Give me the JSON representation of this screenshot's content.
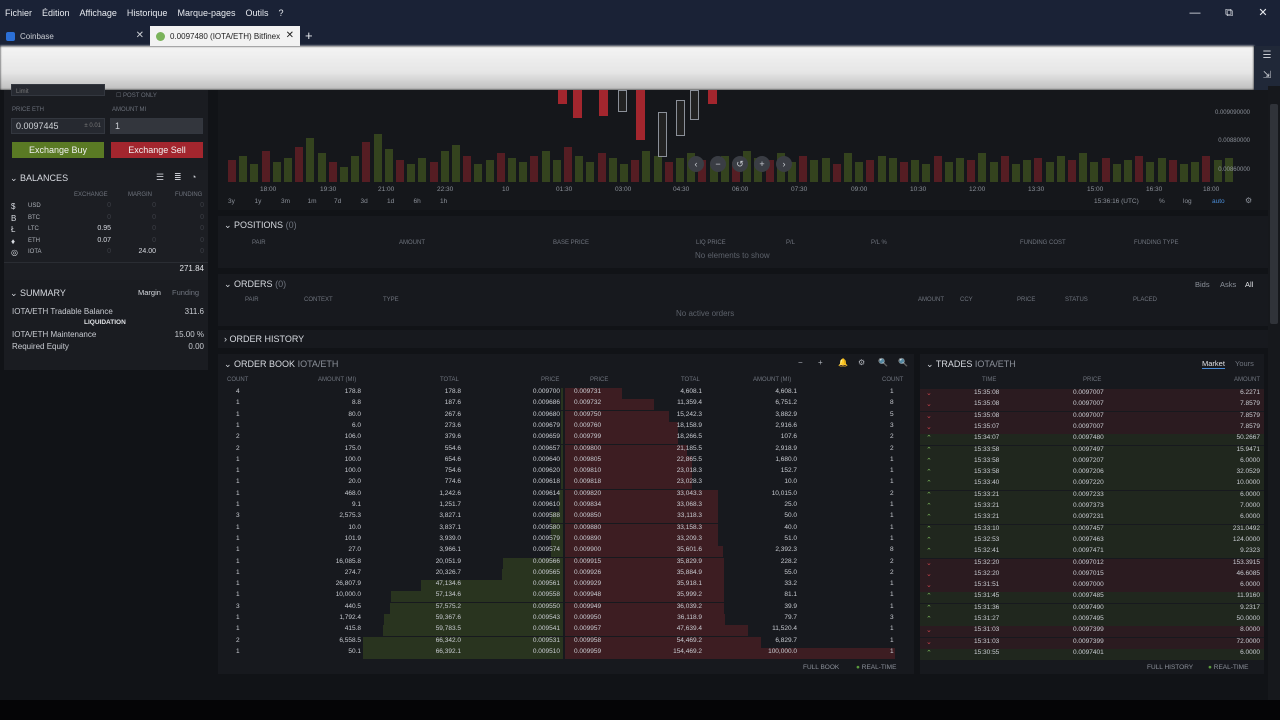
{
  "menu": {
    "items": [
      "Fichier",
      "Édition",
      "Affichage",
      "Historique",
      "Marque-pages",
      "Outils",
      "?"
    ]
  },
  "window_controls": {
    "minimize": "—",
    "maximize": "⧉",
    "close": "✕"
  },
  "tabs": [
    {
      "label": "Coinbase",
      "close": "✕"
    },
    {
      "label": "0.0097480 (IOTA/ETH) Bitfinex",
      "close": "✕"
    }
  ],
  "new_tab": "+",
  "order_form": {
    "type_value": "Limit",
    "post_only": "POST ONLY",
    "price_label": "PRICE ETH",
    "amount_label": "AMOUNT MI",
    "price_value": "0.0097445",
    "price_hint": "± 0.01",
    "amount_value": "1",
    "buy_label": "Exchange Buy",
    "sell_label": "Exchange Sell"
  },
  "balances": {
    "title": "BALANCES",
    "headers": [
      "EXCHANGE",
      "MARGIN",
      "FUNDING"
    ],
    "rows": [
      {
        "sym": "$",
        "cur": "USD",
        "ex": "0",
        "mar": "0",
        "fun": "0"
      },
      {
        "sym": "B",
        "cur": "BTC",
        "ex": "0",
        "mar": "0",
        "fun": "0"
      },
      {
        "sym": "Ł",
        "cur": "LTC",
        "ex": "0.95",
        "mar": "0",
        "fun": "0"
      },
      {
        "sym": "♦",
        "cur": "ETH",
        "ex": "0.07",
        "mar": "0",
        "fun": "0"
      },
      {
        "sym": "◎",
        "cur": "IOTA",
        "ex": "0",
        "mar": "24.00",
        "fun": "0"
      }
    ],
    "total": "271.84"
  },
  "summary": {
    "title": "SUMMARY",
    "tab_margin": "Margin",
    "tab_funding": "Funding",
    "tradable_label": "IOTA/ETH Tradable Balance",
    "tradable_value": "311.6",
    "liquidation": "LIQUIDATION",
    "maintenance_label": "IOTA/ETH Maintenance",
    "maintenance_value": "15.00 %",
    "required_label": "Required Equity",
    "required_value": "0.00"
  },
  "chart": {
    "x_ticks": [
      "18:00",
      "19:30",
      "21:00",
      "22:30",
      "10",
      "01:30",
      "03:00",
      "04:30",
      "06:00",
      "07:30",
      "09:00",
      "10:30",
      "12:00",
      "13:30",
      "15:00",
      "16:30",
      "18:00"
    ],
    "y_ticks": [
      "0.009090000",
      "0.00880000",
      "0.00860000"
    ],
    "timeframes": [
      "3y",
      "1y",
      "3m",
      "1m",
      "7d",
      "3d",
      "1d",
      "6h",
      "1h"
    ],
    "time_label": "15:36:16 (UTC)",
    "pct": "%",
    "log": "log",
    "auto": "auto",
    "gear": "⚙"
  },
  "positions": {
    "title": "POSITIONS",
    "count": "(0)",
    "headers": [
      "PAIR",
      "AMOUNT",
      "BASE PRICE",
      "LIQ PRICE",
      "P/L",
      "P/L %",
      "FUNDING COST",
      "FUNDING TYPE"
    ],
    "empty": "No elements to show"
  },
  "orders": {
    "title": "ORDERS",
    "count": "(0)",
    "headers": [
      "PAIR",
      "CONTEXT",
      "TYPE",
      "AMOUNT",
      "CCY",
      "PRICE",
      "STATUS",
      "PLACED"
    ],
    "empty": "No active orders",
    "filters": [
      "Bids",
      "Asks",
      "All"
    ]
  },
  "order_history": {
    "title": "ORDER HISTORY"
  },
  "order_book": {
    "title": "ORDER BOOK",
    "pair": "IOTA/ETH",
    "icons": [
      "−",
      "+",
      "🔔",
      "⚙",
      "🔍",
      "🔍"
    ],
    "headers_bid": [
      "COUNT",
      "AMOUNT (MI)",
      "TOTAL",
      "PRICE"
    ],
    "headers_ask": [
      "PRICE",
      "TOTAL",
      "AMOUNT (MI)",
      "COUNT"
    ],
    "bids": [
      [
        "4",
        "178.8",
        "178.8",
        "0.009700"
      ],
      [
        "1",
        "8.8",
        "187.6",
        "0.009686"
      ],
      [
        "1",
        "80.0",
        "267.6",
        "0.009680"
      ],
      [
        "1",
        "6.0",
        "273.6",
        "0.009679"
      ],
      [
        "2",
        "106.0",
        "379.6",
        "0.009659"
      ],
      [
        "2",
        "175.0",
        "554.6",
        "0.009657"
      ],
      [
        "1",
        "100.0",
        "654.6",
        "0.009640"
      ],
      [
        "1",
        "100.0",
        "754.6",
        "0.009620"
      ],
      [
        "1",
        "20.0",
        "774.6",
        "0.009618"
      ],
      [
        "1",
        "468.0",
        "1,242.6",
        "0.009614"
      ],
      [
        "1",
        "9.1",
        "1,251.7",
        "0.009610"
      ],
      [
        "3",
        "2,575.3",
        "3,827.1",
        "0.009588"
      ],
      [
        "1",
        "10.0",
        "3,837.1",
        "0.009580"
      ],
      [
        "1",
        "101.9",
        "3,939.0",
        "0.009579"
      ],
      [
        "1",
        "27.0",
        "3,966.1",
        "0.009574"
      ],
      [
        "1",
        "16,085.8",
        "20,051.9",
        "0.009566"
      ],
      [
        "1",
        "274.7",
        "20,326.7",
        "0.009565"
      ],
      [
        "1",
        "26,807.9",
        "47,134.6",
        "0.009561"
      ],
      [
        "1",
        "10,000.0",
        "57,134.6",
        "0.009558"
      ],
      [
        "3",
        "440.5",
        "57,575.2",
        "0.009550"
      ],
      [
        "1",
        "1,792.4",
        "59,367.6",
        "0.009543"
      ],
      [
        "1",
        "415.8",
        "59,783.5",
        "0.009541"
      ],
      [
        "2",
        "6,558.5",
        "66,342.0",
        "0.009531"
      ],
      [
        "1",
        "50.1",
        "66,392.1",
        "0.009510"
      ]
    ],
    "asks": [
      [
        "0.009731",
        "4,608.1",
        "4,608.1",
        "1"
      ],
      [
        "0.009732",
        "11,359.4",
        "6,751.2",
        "8"
      ],
      [
        "0.009750",
        "15,242.3",
        "3,882.9",
        "5"
      ],
      [
        "0.009760",
        "18,158.9",
        "2,916.6",
        "3"
      ],
      [
        "0.009799",
        "18,266.5",
        "107.6",
        "2"
      ],
      [
        "0.009800",
        "21,185.5",
        "2,918.9",
        "2"
      ],
      [
        "0.009805",
        "22,865.5",
        "1,680.0",
        "1"
      ],
      [
        "0.009810",
        "23,018.3",
        "152.7",
        "1"
      ],
      [
        "0.009818",
        "23,028.3",
        "10.0",
        "1"
      ],
      [
        "0.009820",
        "33,043.3",
        "10,015.0",
        "2"
      ],
      [
        "0.009834",
        "33,068.3",
        "25.0",
        "1"
      ],
      [
        "0.009850",
        "33,118.3",
        "50.0",
        "1"
      ],
      [
        "0.009880",
        "33,158.3",
        "40.0",
        "1"
      ],
      [
        "0.009890",
        "33,209.3",
        "51.0",
        "1"
      ],
      [
        "0.009900",
        "35,601.6",
        "2,392.3",
        "8"
      ],
      [
        "0.009915",
        "35,829.9",
        "228.2",
        "2"
      ],
      [
        "0.009926",
        "35,884.9",
        "55.0",
        "2"
      ],
      [
        "0.009929",
        "35,918.1",
        "33.2",
        "1"
      ],
      [
        "0.009948",
        "35,999.2",
        "81.1",
        "1"
      ],
      [
        "0.009949",
        "36,039.2",
        "39.9",
        "1"
      ],
      [
        "0.009950",
        "36,118.9",
        "79.7",
        "3"
      ],
      [
        "0.009957",
        "47,639.4",
        "11,520.4",
        "1"
      ],
      [
        "0.009958",
        "54,469.2",
        "6,829.7",
        "1"
      ],
      [
        "0.009959",
        "154,469.2",
        "100,000.0",
        "1"
      ]
    ],
    "full_book": "FULL BOOK",
    "realtime": "REAL-TIME"
  },
  "trades": {
    "title": "TRADES",
    "pair": "IOTA/ETH",
    "tab_market": "Market",
    "tab_yours": "Yours",
    "headers": [
      "TIME",
      "PRICE",
      "AMOUNT"
    ],
    "rows": [
      [
        "dn",
        "15:35:08",
        "0.0097007",
        "6.2271"
      ],
      [
        "dn",
        "15:35:08",
        "0.0097007",
        "7.8579"
      ],
      [
        "dn",
        "15:35:08",
        "0.0097007",
        "7.8579"
      ],
      [
        "dn",
        "15:35:07",
        "0.0097007",
        "7.8579"
      ],
      [
        "up",
        "15:34:07",
        "0.0097480",
        "50.2667"
      ],
      [
        "up",
        "15:33:58",
        "0.0097497",
        "15.9471"
      ],
      [
        "up",
        "15:33:58",
        "0.0097207",
        "6.0000"
      ],
      [
        "up",
        "15:33:58",
        "0.0097206",
        "32.0529"
      ],
      [
        "up",
        "15:33:40",
        "0.0097220",
        "10.0000"
      ],
      [
        "up",
        "15:33:21",
        "0.0097233",
        "6.0000"
      ],
      [
        "up",
        "15:33:21",
        "0.0097373",
        "7.0000"
      ],
      [
        "up",
        "15:33:21",
        "0.0097231",
        "6.0000"
      ],
      [
        "up",
        "15:33:10",
        "0.0097457",
        "231.0492"
      ],
      [
        "up",
        "15:32:53",
        "0.0097463",
        "124.0000"
      ],
      [
        "up",
        "15:32:41",
        "0.0097471",
        "9.2323"
      ],
      [
        "dn",
        "15:32:20",
        "0.0097012",
        "153.3915"
      ],
      [
        "dn",
        "15:32:20",
        "0.0097015",
        "46.6085"
      ],
      [
        "dn",
        "15:31:51",
        "0.0097000",
        "6.0000"
      ],
      [
        "up",
        "15:31:45",
        "0.0097485",
        "11.9160"
      ],
      [
        "up",
        "15:31:36",
        "0.0097490",
        "9.2317"
      ],
      [
        "up",
        "15:31:27",
        "0.0097495",
        "50.0000"
      ],
      [
        "dn",
        "15:31:03",
        "0.0097399",
        "8.0000"
      ],
      [
        "dn",
        "15:31:03",
        "0.0097399",
        "72.0000"
      ],
      [
        "up",
        "15:30:55",
        "0.0097401",
        "6.0000"
      ]
    ],
    "full_history": "FULL HISTORY",
    "realtime": "REAL-TIME"
  },
  "colors": {
    "buy": "#5a7a24",
    "sell": "#a3262e",
    "up": "#7ab35a",
    "down": "#c9424a",
    "accent": "#4a8cd6"
  }
}
